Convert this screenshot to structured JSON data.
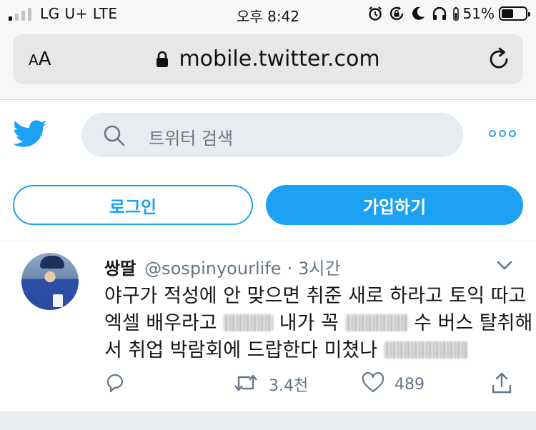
{
  "status_bar": {
    "carrier": "LG U+ LTE",
    "time": "오후 8:42",
    "battery_percent": "51%",
    "battery_level": 0.51,
    "signal_bars_active": 1,
    "signal_bars_total": 4,
    "icons": [
      "alarm-icon",
      "rotation-lock-icon",
      "moon-icon",
      "headphones-icon",
      "battery-icon"
    ]
  },
  "browser": {
    "text_size_button": "AA",
    "url": "mobile.twitter.com",
    "icons": [
      "lock-icon",
      "reload-icon"
    ]
  },
  "header": {
    "logo": "twitter-bird-icon",
    "search_placeholder": "트위터 검색",
    "more_icon": "more-icon"
  },
  "auth": {
    "login_label": "로그인",
    "signup_label": "가입하기"
  },
  "tweet": {
    "author_name": "쌍딸",
    "author_handle": "@sospinyourlife",
    "separator": "·",
    "time": "3시간",
    "text_lines": [
      "야구가 적성에 안 맞으면 취준 새로 하라고 토익 따고",
      [
        "엑셀 배우라고 ",
        " 내가 꼭 ",
        " 수 버스 탈취해"
      ],
      [
        "서 취업 박람회에 드랍한다 미쳤나 ",
        ""
      ]
    ],
    "actions": {
      "reply": "",
      "retweet": "3.4천",
      "like": "489",
      "share": ""
    }
  },
  "colors": {
    "accent": "#1da1f2",
    "secondary_text": "#657786",
    "search_bg": "#e6ecf0"
  }
}
